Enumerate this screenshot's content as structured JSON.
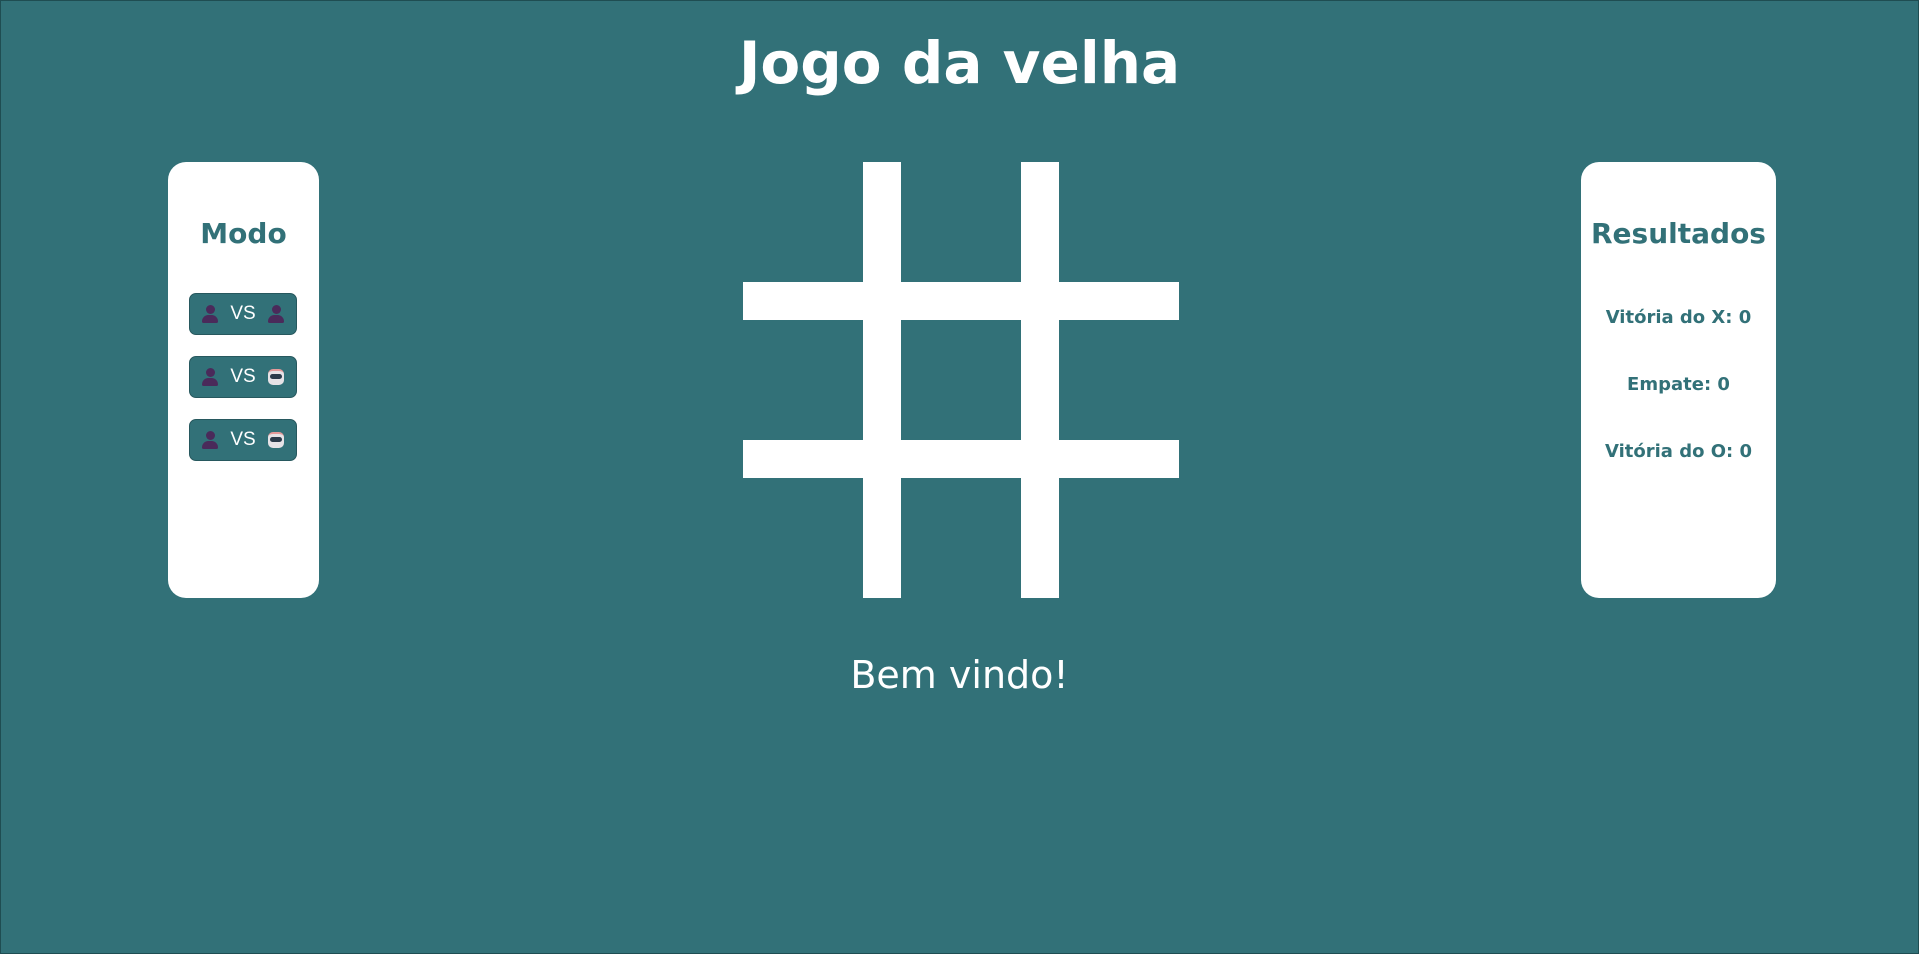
{
  "title": "Jogo da velha",
  "mode_panel": {
    "title": "Modo",
    "buttons": [
      {
        "left_icon": "person-icon",
        "label": "VS",
        "right_icon": "person-icon"
      },
      {
        "left_icon": "person-icon",
        "label": "VS",
        "right_icon": "robot-icon"
      },
      {
        "left_icon": "person-icon",
        "label": "VS",
        "right_icon": "robot-icon"
      }
    ]
  },
  "results_panel": {
    "title": "Resultados",
    "x_wins": "Vitória do X: 0",
    "draws": "Empate: 0",
    "o_wins": "Vitória do O: 0"
  },
  "board": {
    "cells": [
      "",
      "",
      "",
      "",
      "",
      "",
      "",
      "",
      ""
    ]
  },
  "message": "Bem vindo!",
  "colors": {
    "background": "#327178",
    "panel": "#ffffff",
    "accent_text": "#327178",
    "person_icon": "#4a2a5a"
  }
}
